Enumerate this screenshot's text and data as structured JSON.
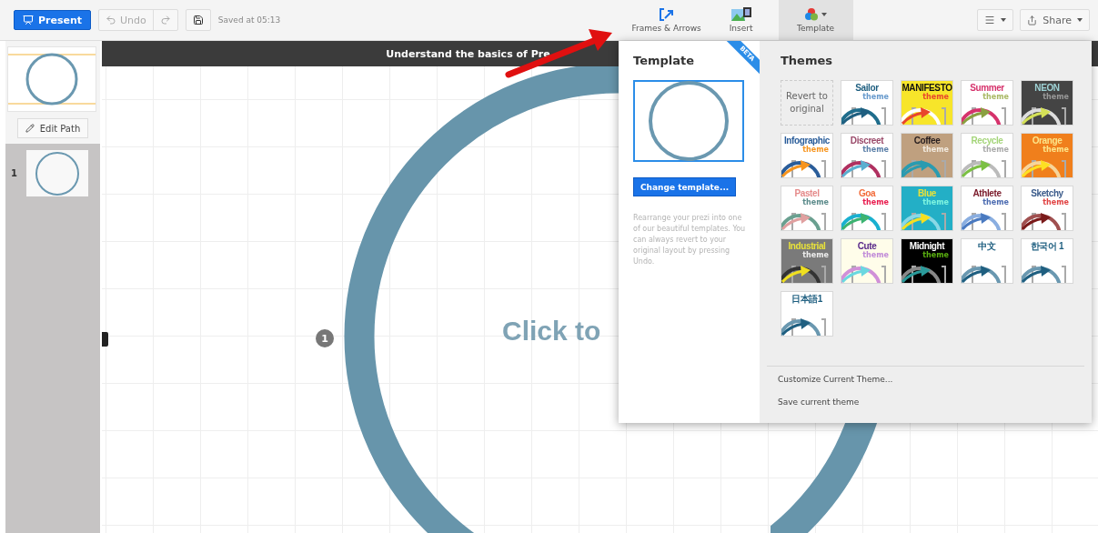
{
  "toolbar": {
    "present": "Present",
    "undo": "Undo",
    "saved": "Saved at 05:13",
    "share": "Share",
    "tools": [
      {
        "kind": "frames",
        "label": "Frames & Arrows",
        "selected": false
      },
      {
        "kind": "insert",
        "label": "Insert",
        "selected": false
      },
      {
        "kind": "template",
        "label": "Template",
        "selected": true
      }
    ]
  },
  "sidebar": {
    "edit_path": "Edit Path",
    "slides": [
      {
        "number": "1"
      }
    ]
  },
  "canvas": {
    "title": "Understand the basics of Pre",
    "placeholder_text": "Click to",
    "path_badge": "1"
  },
  "template_panel": {
    "title": "Template",
    "badge": "BETA",
    "button": "Change template...",
    "description": "Rearrange your prezi into one of our beautiful templates. You can always revert to your original layout by pressing Undo.",
    "themes_title": "Themes",
    "themes": [
      {
        "kind": "revert",
        "title": {
          "text": "Revert to original"
        }
      },
      {
        "kind": "theme",
        "color": "#ffffff",
        "title": {
          "text": "Sailor",
          "color": "#1f5f80"
        },
        "subtitle": {
          "text": "theme",
          "color": "#6699cc"
        },
        "ring": {
          "color": "#1f6d8c"
        },
        "arrow": {
          "color": "#1f5f80"
        }
      },
      {
        "kind": "theme",
        "color": "#f7e52a",
        "title": {
          "text": "MANIFESTO",
          "color": "#111111"
        },
        "subtitle": {
          "text": "theme",
          "color": "#e8452c"
        },
        "ring": {
          "color": "#ffffff"
        },
        "arrow": {
          "color": "#e8452c"
        }
      },
      {
        "kind": "theme",
        "color": "#ffffff",
        "title": {
          "text": "Summer",
          "color": "#d6336c"
        },
        "subtitle": {
          "text": "theme",
          "color": "#a8b862"
        },
        "ring": {
          "color": "#d6336c"
        },
        "arrow": {
          "color": "#8aa040"
        }
      },
      {
        "kind": "theme",
        "color": "#444444",
        "title": {
          "text": "NEON",
          "color": "#9fd3d6"
        },
        "subtitle": {
          "text": "theme",
          "color": "#999999"
        },
        "ring": {
          "color": "#dddddd"
        },
        "arrow": {
          "color": "#d4e157"
        }
      },
      {
        "kind": "theme",
        "color": "#ffffff",
        "title": {
          "text": "Infographic",
          "color": "#2a5d9a"
        },
        "subtitle": {
          "text": "theme",
          "color": "#f7941d"
        },
        "ring": {
          "color": "#2a5d9a"
        },
        "arrow": {
          "color": "#f7941d"
        }
      },
      {
        "kind": "theme",
        "color": "#ffffff",
        "title": {
          "text": "Discreet",
          "color": "#9a4a6a"
        },
        "subtitle": {
          "text": "theme",
          "color": "#5b7fa8"
        },
        "ring": {
          "color": "#b03060"
        },
        "arrow": {
          "color": "#5aaed0"
        }
      },
      {
        "kind": "theme",
        "color": "#bfa07f",
        "title": {
          "text": "Coffee",
          "color": "#2a2020"
        },
        "subtitle": {
          "text": "theme",
          "color": "#f2eadf"
        },
        "ring": {
          "color": "#2a9bb0"
        },
        "arrow": {
          "color": "#2a9bb0"
        }
      },
      {
        "kind": "theme",
        "color": "#ffffff",
        "title": {
          "text": "Recycle",
          "color": "#a5d57a"
        },
        "subtitle": {
          "text": "theme",
          "color": "#aaaaaa"
        },
        "ring": {
          "color": "#bbbbbb"
        },
        "arrow": {
          "color": "#7bc043"
        }
      },
      {
        "kind": "theme",
        "color": "#f07f1c",
        "title": {
          "text": "Orange",
          "color": "#fde68a"
        },
        "subtitle": {
          "text": "theme",
          "color": "#fde68a"
        },
        "ring": {
          "color": "#f7d59a"
        },
        "arrow": {
          "color": "#fde022"
        }
      },
      {
        "kind": "theme",
        "color": "#ffffff",
        "title": {
          "text": "Pastel",
          "color": "#e58a8a"
        },
        "subtitle": {
          "text": "theme",
          "color": "#5a8a8a"
        },
        "ring": {
          "color": "#6aa090"
        },
        "arrow": {
          "color": "#e0a0a0"
        }
      },
      {
        "kind": "theme",
        "color": "#ffffff",
        "title": {
          "text": "Goa",
          "color": "#f26b3a"
        },
        "subtitle": {
          "text": "theme",
          "color": "#e8184b"
        },
        "ring": {
          "color": "#1ab0d0"
        },
        "arrow": {
          "color": "#3cb371"
        }
      },
      {
        "kind": "theme",
        "color": "#23afc6",
        "title": {
          "text": "Blue",
          "color": "#e8e23a"
        },
        "subtitle": {
          "text": "theme",
          "color": "#7ff5e0"
        },
        "ring": {
          "color": "#8ad8e6"
        },
        "arrow": {
          "color": "#f5e020"
        }
      },
      {
        "kind": "theme",
        "color": "#ffffff",
        "title": {
          "text": "Athlete",
          "color": "#7a1a2a"
        },
        "subtitle": {
          "text": "theme",
          "color": "#4a6ab0"
        },
        "ring": {
          "color": "#8aaee0"
        },
        "arrow": {
          "color": "#4a7ac0"
        }
      },
      {
        "kind": "theme",
        "color": "#ffffff",
        "title": {
          "text": "Sketchy",
          "color": "#3a5a8a"
        },
        "subtitle": {
          "text": "theme",
          "color": "#e04040"
        },
        "ring": {
          "color": "#a05050"
        },
        "arrow": {
          "color": "#7a1a1a"
        }
      },
      {
        "kind": "theme",
        "color": "#7a7a7a",
        "title": {
          "text": "Industrial",
          "color": "#e8e23a"
        },
        "subtitle": {
          "text": "theme",
          "color": "#eeeeee"
        },
        "ring": {
          "color": "#333333"
        },
        "arrow": {
          "color": "#f0e020"
        }
      },
      {
        "kind": "theme",
        "color": "#fffdea",
        "title": {
          "text": "Cute",
          "color": "#5a2a8a"
        },
        "subtitle": {
          "text": "theme",
          "color": "#c08ad8"
        },
        "ring": {
          "color": "#d090d8"
        },
        "arrow": {
          "color": "#6ad8e0"
        }
      },
      {
        "kind": "theme",
        "color": "#000000",
        "title": {
          "text": "Midnight",
          "color": "#ffffff"
        },
        "subtitle": {
          "text": "theme",
          "color": "#5ab010"
        },
        "ring": {
          "color": "#888888"
        },
        "arrow": {
          "color": "#2a9a9a"
        }
      },
      {
        "kind": "theme",
        "color": "#ffffff",
        "title": {
          "text": "中文",
          "color": "#1f5f80"
        },
        "ring": {
          "color": "#6a98b0"
        },
        "arrow": {
          "color": "#1f5f80"
        }
      },
      {
        "kind": "theme",
        "color": "#ffffff",
        "title": {
          "text": "한국어 1",
          "color": "#1f5f80"
        },
        "ring": {
          "color": "#6a98b0"
        },
        "arrow": {
          "color": "#1f5f80"
        }
      },
      {
        "kind": "theme",
        "color": "#ffffff",
        "title": {
          "text": "日本語1",
          "color": "#1f5f80"
        },
        "ring": {
          "color": "#6a98b0"
        },
        "arrow": {
          "color": "#1f5f80"
        }
      }
    ],
    "actions": [
      "Customize Current Theme...",
      "Save current theme"
    ]
  }
}
